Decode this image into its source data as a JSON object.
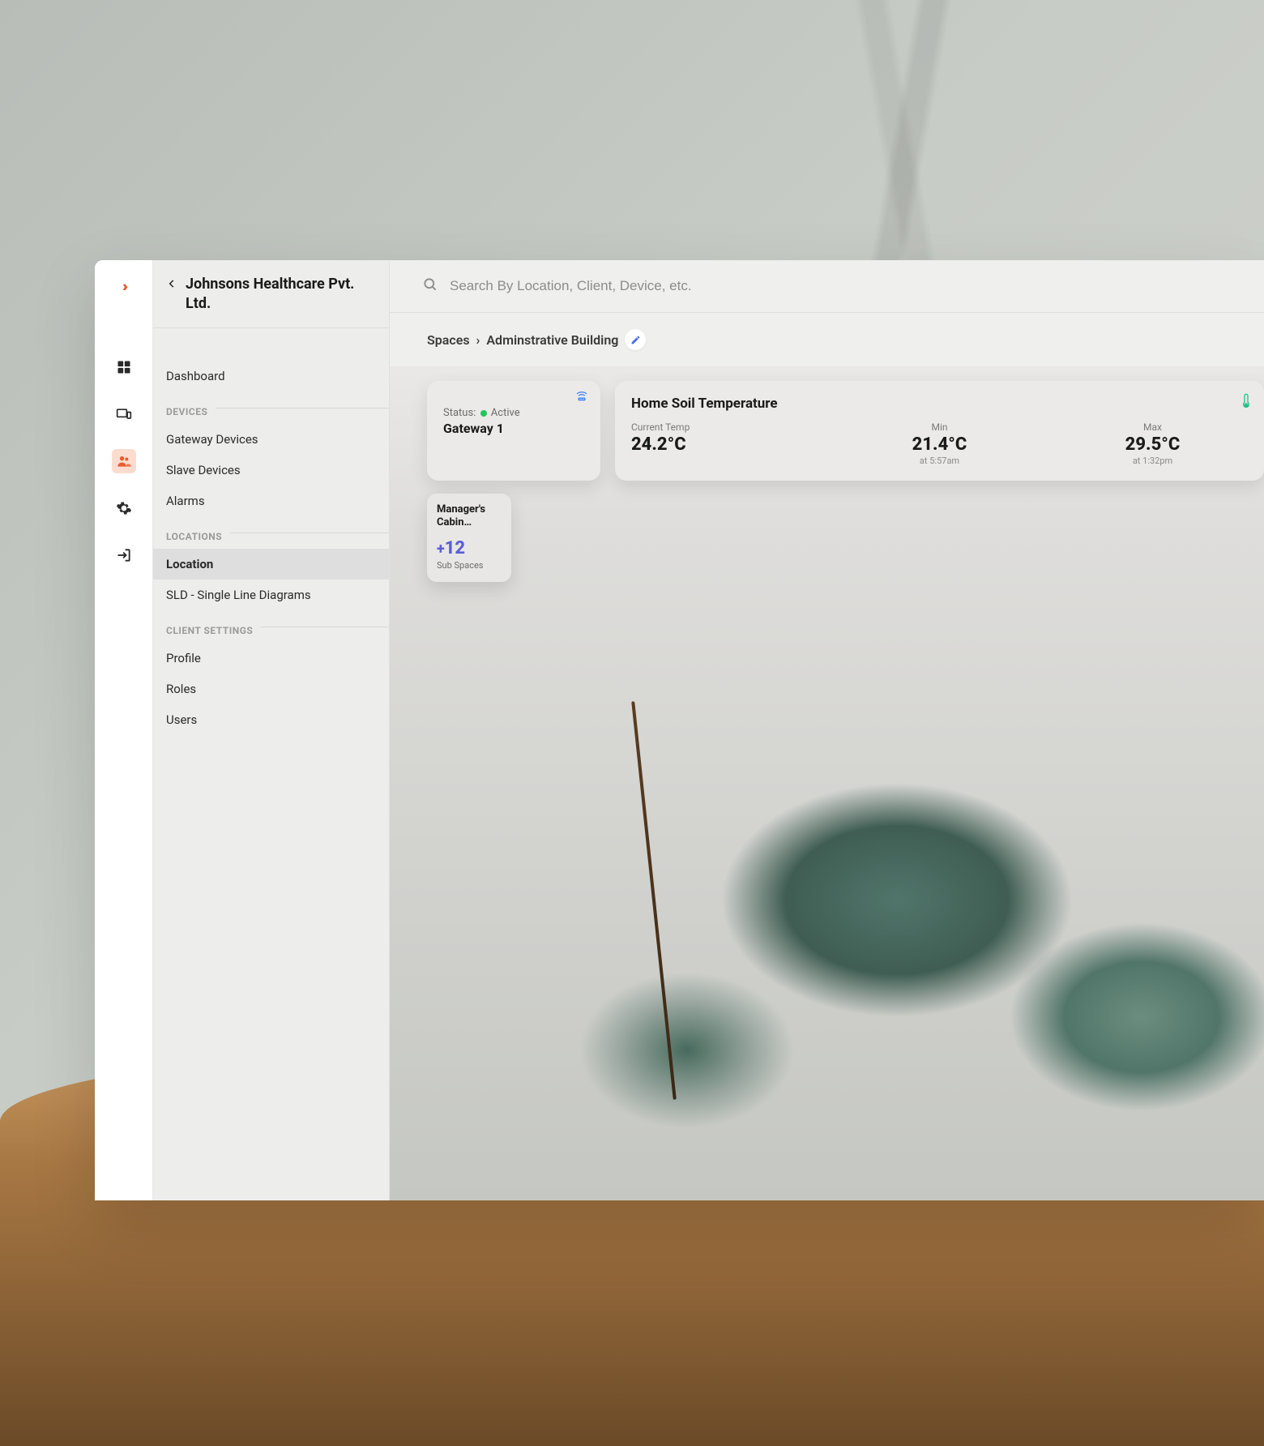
{
  "org_name": "Johnsons Healthcare Pvt. Ltd.",
  "nav": {
    "dashboard": "Dashboard",
    "sections": {
      "devices": {
        "label": "DEVICES",
        "items": {
          "gateway": "Gateway Devices",
          "slave": "Slave Devices",
          "alarms": "Alarms"
        }
      },
      "locations": {
        "label": "LOCATIONS",
        "items": {
          "location": "Location",
          "sld": "SLD - Single Line Diagrams"
        }
      },
      "client_settings": {
        "label": "CLIENT SETTINGS",
        "items": {
          "profile": "Profile",
          "roles": "Roles",
          "users": "Users"
        }
      }
    }
  },
  "search": {
    "placeholder": "Search By Location, Client, Device, etc."
  },
  "breadcrumb": {
    "root": "Spaces",
    "current": "Adminstrative Building"
  },
  "gateway_card": {
    "status_label": "Status:",
    "status_value": "Active",
    "name": "Gateway 1"
  },
  "temp_card": {
    "title": "Home Soil Temperature",
    "current": {
      "label": "Current Temp",
      "value": "24.2°C"
    },
    "min": {
      "label": "Min",
      "value": "21.4°C",
      "time": "at 5:57am"
    },
    "max": {
      "label": "Max",
      "value": "29.5°C",
      "time": "at 1:32pm"
    }
  },
  "sub_card": {
    "name": "Manager's Cabin…",
    "count_prefix": "+",
    "count": "12",
    "label": "Sub Spaces"
  }
}
